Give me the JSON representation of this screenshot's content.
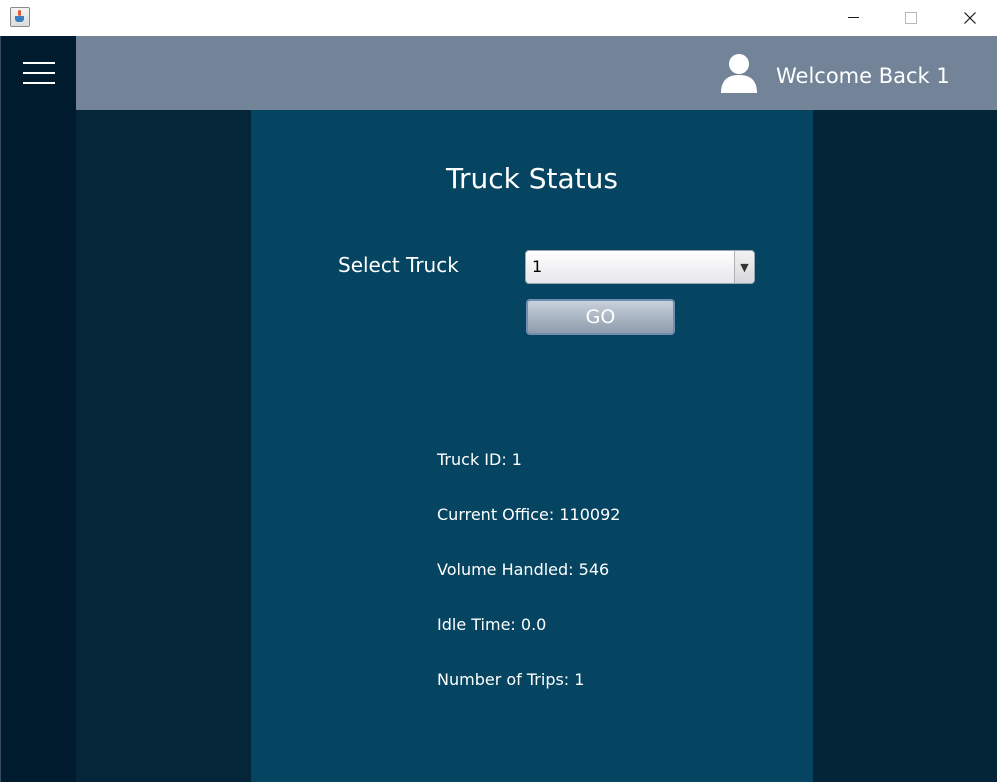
{
  "window": {
    "icon": "java-coffee-icon",
    "controls": [
      "minimize-icon",
      "maximize-icon",
      "close-icon"
    ]
  },
  "nav": {
    "menu_icon": "hamburger-menu-icon"
  },
  "header": {
    "user_icon": "user-icon",
    "welcome": "Welcome Back 1"
  },
  "main": {
    "title": "Truck Status",
    "select_label": "Select Truck",
    "selected_truck": "1",
    "go_label": "GO",
    "details": {
      "truck_id": "Truck ID: 1",
      "current_office": "Current Office: 110092",
      "volume_handled": "Volume Handled: 546",
      "idle_time": "Idle Time: 0.0",
      "number_of_trips": "Number of Trips: 1"
    }
  },
  "colors": {
    "header": "#738499",
    "nav": "#011b2e",
    "panel": "#064562",
    "side": "#042537",
    "text": "#ffffff"
  }
}
